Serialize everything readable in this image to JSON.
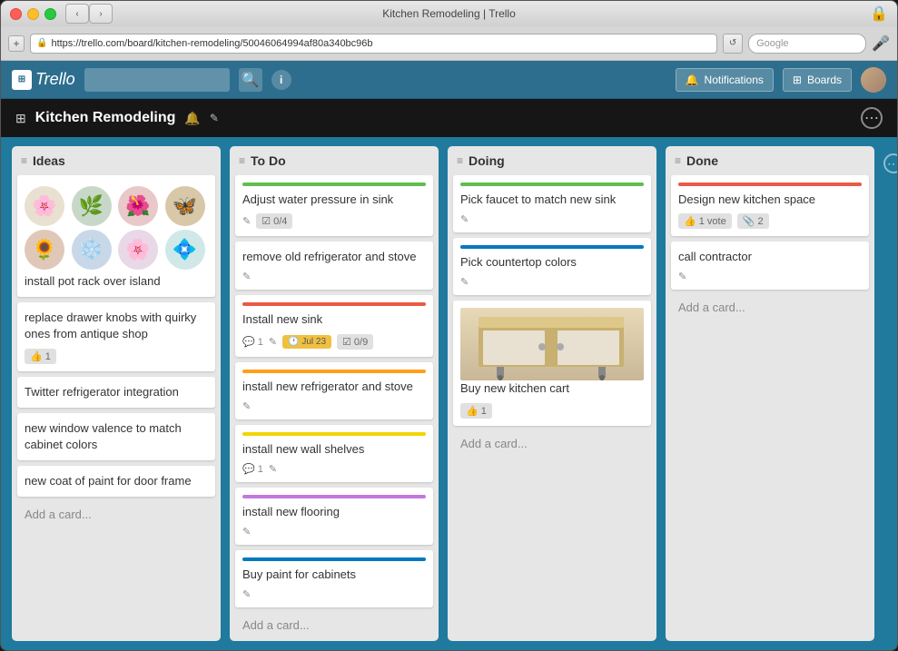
{
  "window": {
    "title": "Kitchen Remodeling | Trello"
  },
  "browser": {
    "url": "https://trello.com/board/kitchen-remodeling/50046064994af80a340bc96b",
    "search_placeholder": "Google"
  },
  "header": {
    "logo": "Trello",
    "logo_icon": "⊞",
    "notifications_label": "Notifications",
    "boards_label": "Boards",
    "search_placeholder": ""
  },
  "board": {
    "title": "Kitchen Remodeling",
    "settings_icon": "⚙"
  },
  "lists": [
    {
      "id": "ideas",
      "title": "Ideas",
      "cards": [
        {
          "id": "c1",
          "title": "install pot rack over island",
          "has_image": true,
          "bar_color": null
        },
        {
          "id": "c2",
          "title": "replace drawer knobs with quirky ones from antique shop",
          "bar_color": null,
          "votes": 1
        },
        {
          "id": "c3",
          "title": "Twitter refrigerator integration",
          "bar_color": null
        },
        {
          "id": "c4",
          "title": "new window valence to match cabinet colors",
          "bar_color": null
        },
        {
          "id": "c5",
          "title": "new coat of paint for door frame",
          "bar_color": null
        }
      ],
      "add_label": "Add a card..."
    },
    {
      "id": "todo",
      "title": "To Do",
      "cards": [
        {
          "id": "t1",
          "title": "Adjust water pressure in sink",
          "bar_color": "green",
          "checklist": "0/4",
          "has_edit": true
        },
        {
          "id": "t2",
          "title": "remove old refrigerator and stove",
          "bar_color": null,
          "has_edit": true
        },
        {
          "id": "t3",
          "title": "Install new sink",
          "bar_color": "red",
          "comments": 1,
          "has_edit": true,
          "due_date": "Jul 23",
          "checklist": "0/9"
        },
        {
          "id": "t4",
          "title": "install new refrigerator and stove",
          "bar_color": "orange",
          "has_edit": true
        },
        {
          "id": "t5",
          "title": "install new wall shelves",
          "bar_color": "yellow",
          "comments": 1,
          "has_edit": true
        },
        {
          "id": "t6",
          "title": "install new flooring",
          "bar_color": "purple",
          "has_edit": true
        },
        {
          "id": "t7",
          "title": "Buy paint for cabinets",
          "bar_color": "blue",
          "has_edit": true
        }
      ],
      "add_label": "Add a card..."
    },
    {
      "id": "doing",
      "title": "Doing",
      "cards": [
        {
          "id": "d1",
          "title": "Pick faucet to match new sink",
          "bar_color": "green",
          "has_edit": true
        },
        {
          "id": "d2",
          "title": "Pick countertop colors",
          "bar_color": "blue",
          "has_edit": true
        },
        {
          "id": "d3",
          "title": "Buy new kitchen cart",
          "has_image": true,
          "bar_color": null,
          "votes": 1
        }
      ],
      "add_label": "Add a card..."
    },
    {
      "id": "done",
      "title": "Done",
      "cards": [
        {
          "id": "dn1",
          "title": "Design new kitchen space",
          "bar_color": "red",
          "votes": 1,
          "vote_count": 1,
          "attachments": 2
        },
        {
          "id": "dn2",
          "title": "call contractor",
          "bar_color": null,
          "has_edit": true
        }
      ],
      "add_label": "Add a card..."
    }
  ],
  "labels": {
    "vote": "👍",
    "comment": "💬",
    "checklist": "☑",
    "clock": "🕐",
    "edit": "✎",
    "attachment": "📎"
  }
}
